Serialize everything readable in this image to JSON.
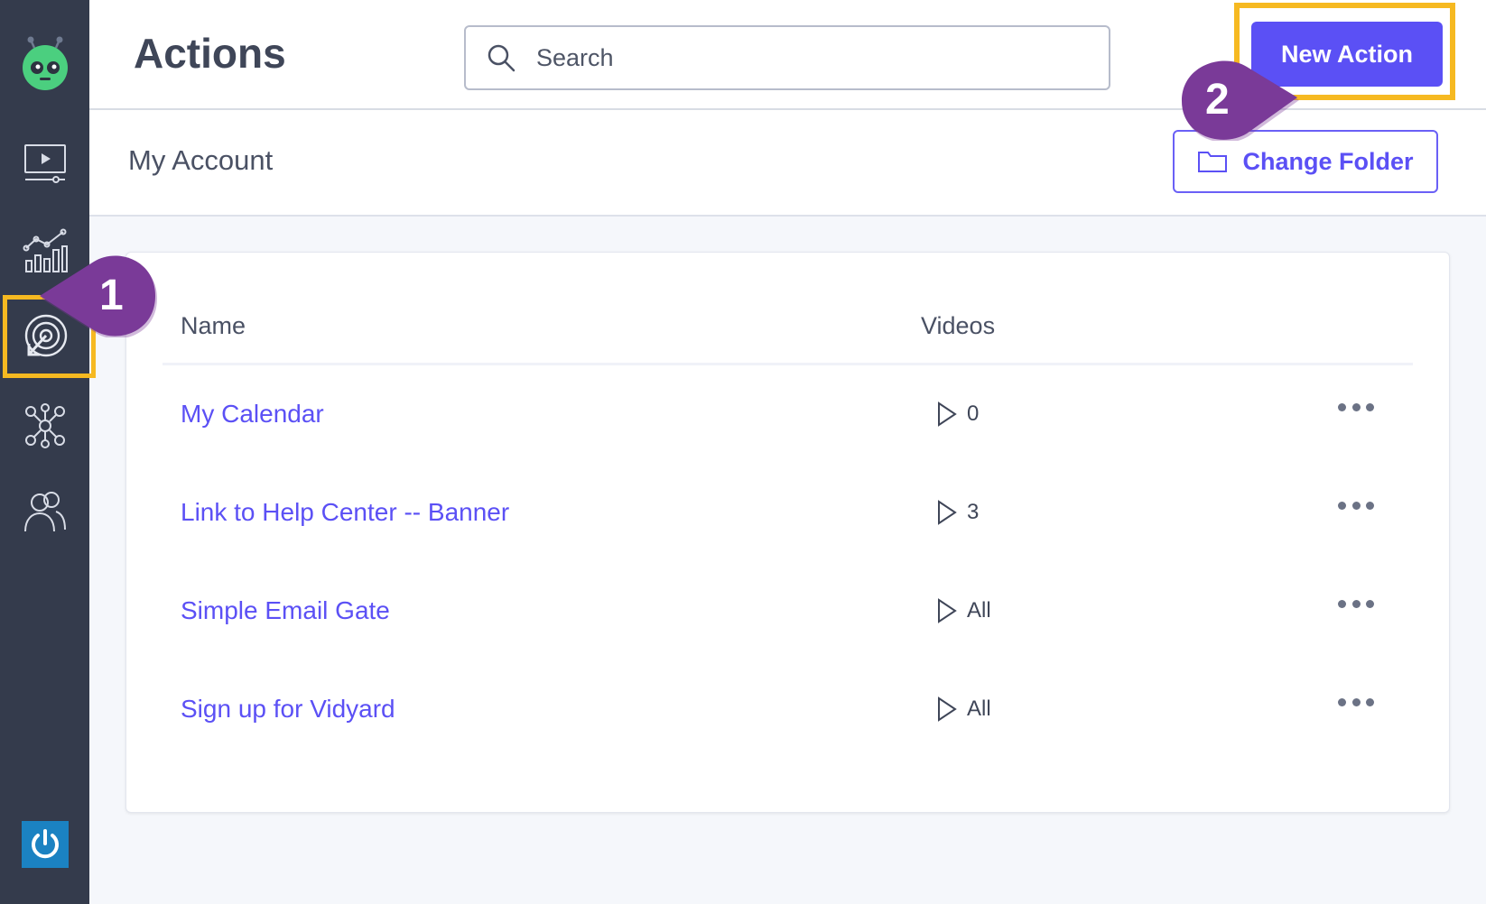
{
  "header": {
    "title": "Actions",
    "search_placeholder": "Search",
    "new_action_label": "New Action"
  },
  "subheader": {
    "account_label": "My Account",
    "change_folder_label": "Change Folder"
  },
  "table": {
    "columns": [
      "Name",
      "Videos"
    ],
    "rows": [
      {
        "name": "My Calendar",
        "videos": "0"
      },
      {
        "name": "Link to Help Center -- Banner",
        "videos": "3"
      },
      {
        "name": "Simple Email Gate",
        "videos": "All"
      },
      {
        "name": "Sign up for Vidyard",
        "videos": "All"
      }
    ]
  },
  "annotations": {
    "step1": "1",
    "step2": "2"
  },
  "colors": {
    "sidebar": "#343b4c",
    "accent": "#5b50f5",
    "highlight": "#f6b921",
    "callout": "#7a3a98"
  },
  "sidebar": {
    "icons": [
      "vidyard-logo-icon",
      "video-library-icon",
      "analytics-icon",
      "actions-target-icon",
      "integrations-icon",
      "team-icon",
      "power-icon"
    ]
  }
}
